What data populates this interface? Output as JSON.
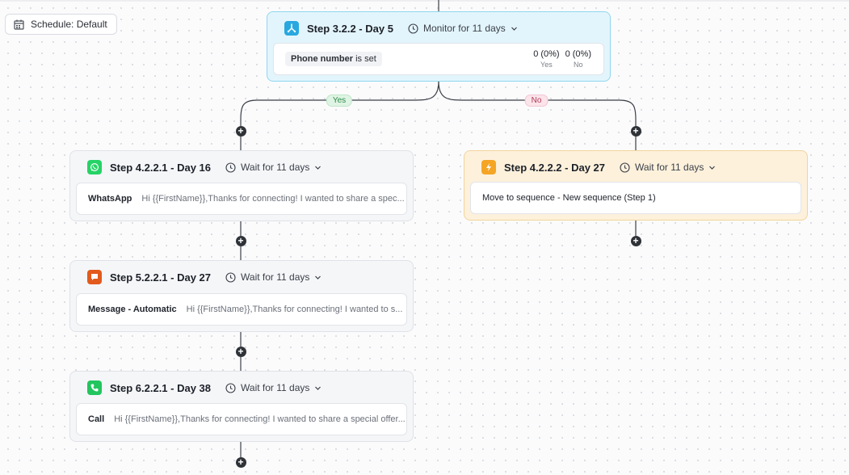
{
  "schedule": {
    "label": "Schedule: Default",
    "icon": "calendar-icon"
  },
  "branches": {
    "yes_label": "Yes",
    "no_label": "No"
  },
  "colors": {
    "monitor_bg": "#e3f5fc",
    "action_bg": "#fdf1dc",
    "whatsapp": "#25d366",
    "message": "#e25a1c",
    "call": "#22c55e",
    "sequence": "#f5a524",
    "monitor_icon": "#29a8e0"
  },
  "steps": {
    "monitor": {
      "title": "Step 3.2.2 - Day 5",
      "wait": "Monitor for 11 days",
      "icon": "branch-icon",
      "condition_field": "Phone number",
      "condition_op": "is set",
      "yes_value": "0 (0%)",
      "yes_label": "Yes",
      "no_value": "0 (0%)",
      "no_label": "No"
    },
    "whatsapp": {
      "title": "Step 4.2.2.1 - Day 16",
      "wait": "Wait for 11 days",
      "icon": "whatsapp-icon",
      "label": "WhatsApp",
      "text": "Hi {{FirstName}},Thanks for connecting! I wanted to share a spec..."
    },
    "sequence": {
      "title": "Step 4.2.2.2 - Day 27",
      "wait": "Wait for 11 days",
      "icon": "lightning-icon",
      "label": "Move to sequence - New sequence (Step 1)"
    },
    "message": {
      "title": "Step 5.2.2.1 - Day 27",
      "wait": "Wait for 11 days",
      "icon": "message-icon",
      "label": "Message - Automatic",
      "text": "Hi {{FirstName}},Thanks for connecting! I wanted to s..."
    },
    "call": {
      "title": "Step 6.2.2.1 - Day 38",
      "wait": "Wait for 11 days",
      "icon": "phone-icon",
      "label": "Call",
      "text": "Hi {{FirstName}},Thanks for connecting! I wanted to share a special offer..."
    }
  }
}
